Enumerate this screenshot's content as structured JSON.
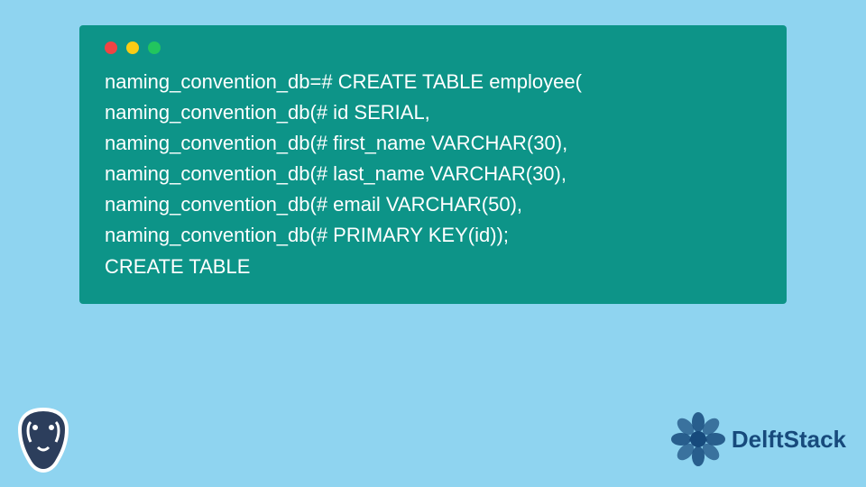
{
  "terminal": {
    "lines": [
      "naming_convention_db=# CREATE TABLE employee(",
      "naming_convention_db(# id SERIAL,",
      "naming_convention_db(# first_name VARCHAR(30),",
      "naming_convention_db(# last_name VARCHAR(30),",
      "naming_convention_db(# email VARCHAR(50),",
      "naming_convention_db(# PRIMARY KEY(id));",
      "CREATE TABLE"
    ]
  },
  "branding": {
    "site_name": "DelftStack"
  },
  "colors": {
    "background": "#8fd4f0",
    "terminal_bg": "#0d9488",
    "dot_red": "#ef4444",
    "dot_yellow": "#facc15",
    "dot_green": "#22c55e"
  }
}
